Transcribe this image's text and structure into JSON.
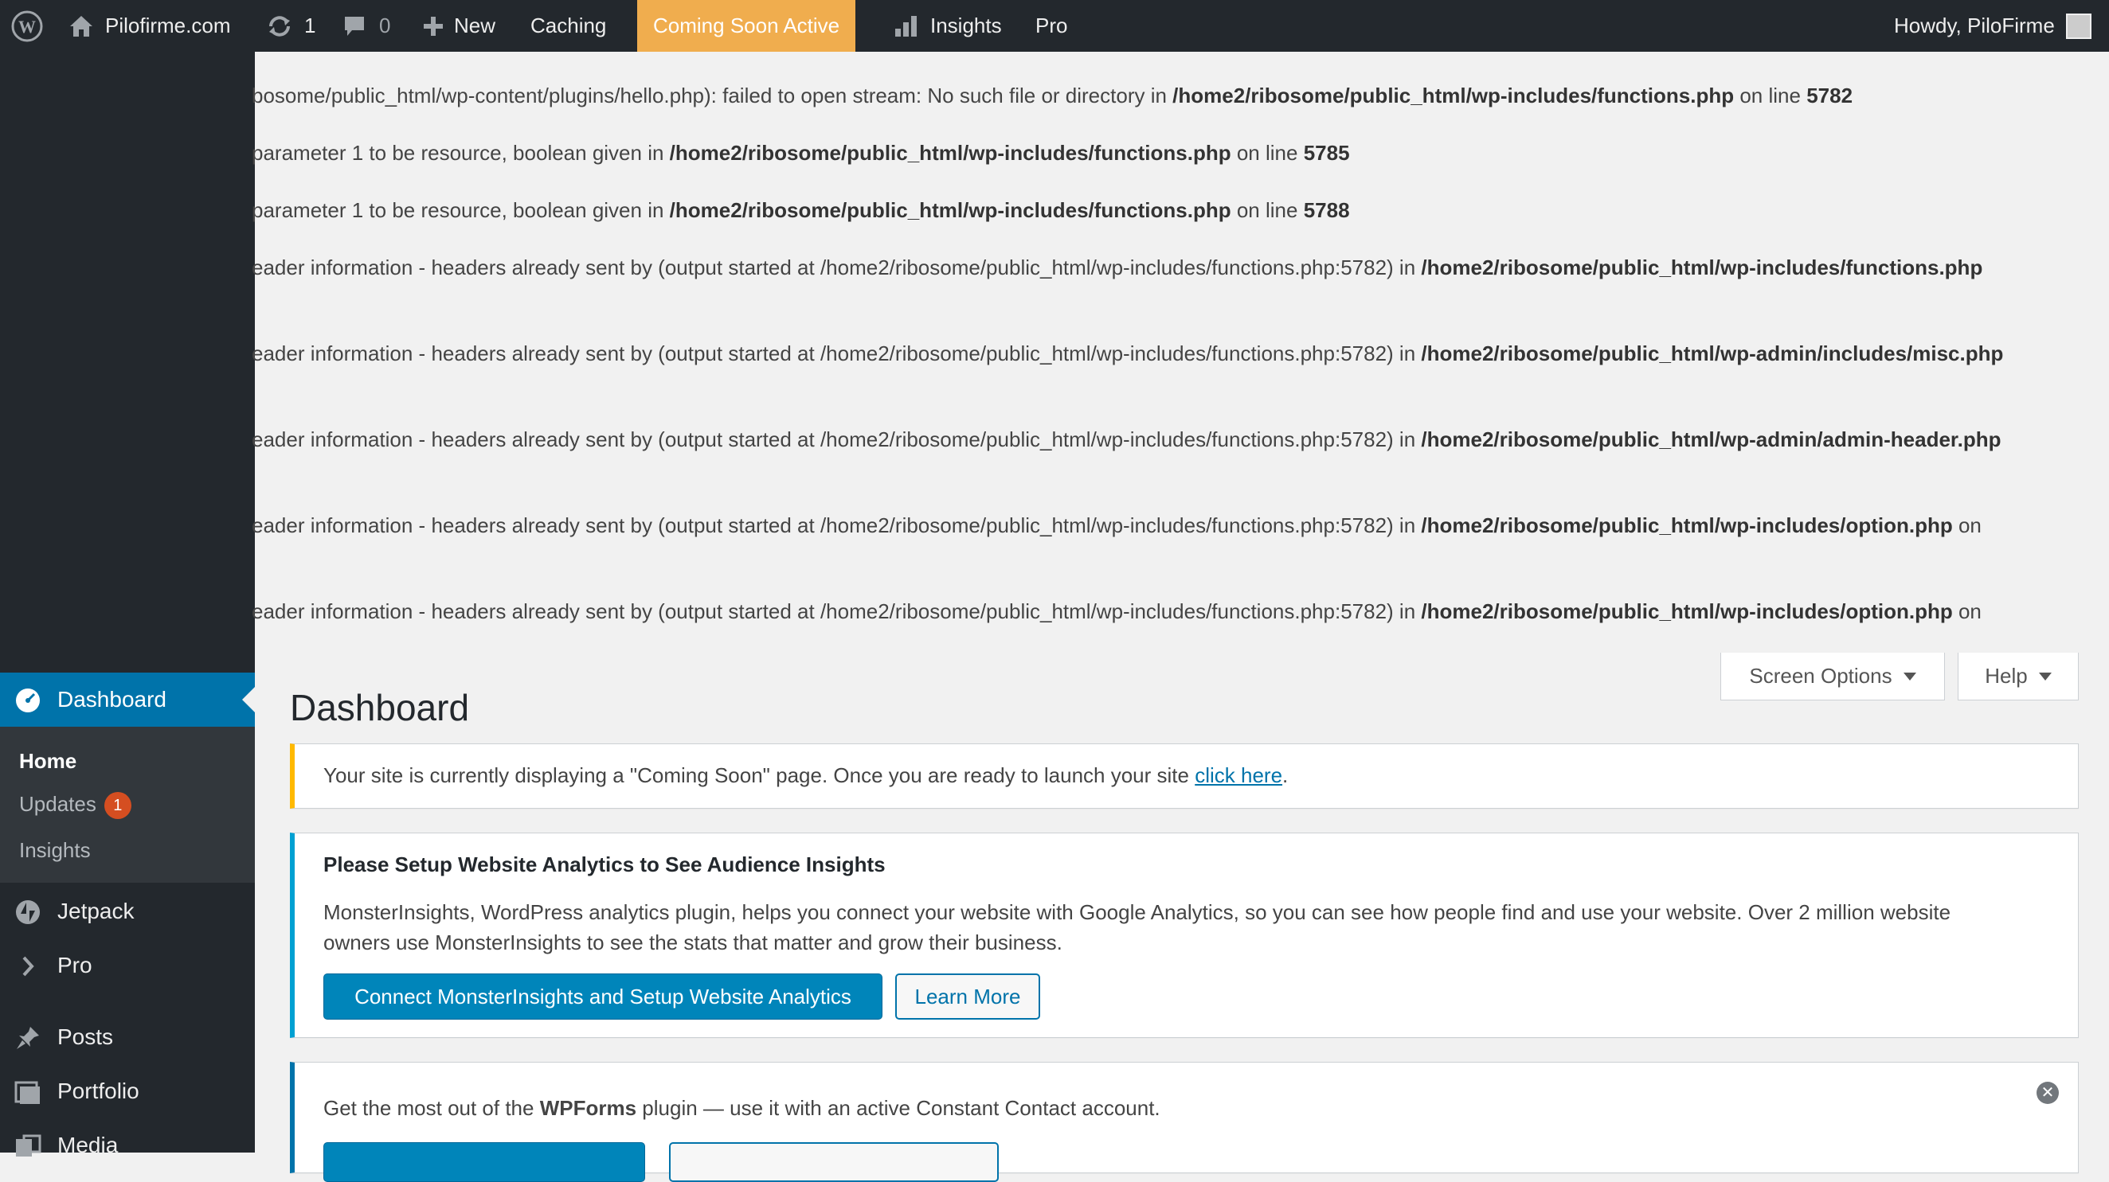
{
  "adminbar": {
    "site_name": "Pilofirme.com",
    "updates_count": "1",
    "comments_count": "0",
    "new_label": "New",
    "caching_label": "Caching",
    "coming_soon_label": "Coming Soon Active",
    "insights_label": "Insights",
    "pro_label": "Pro",
    "howdy": "Howdy, PiloFirme",
    "icons": [
      "wordpress-logo-icon",
      "home-icon",
      "refresh-icon",
      "comment-icon",
      "plus-icon",
      "bar-chart-icon"
    ]
  },
  "errors": [
    {
      "text": "bosome/public_html/wp-content/plugins/hello.php): failed to open stream: No such file or directory in ",
      "path": "/home2/ribosome/public_html/wp-includes/functions.php",
      "suffix": " on line ",
      "line": "5782"
    },
    {
      "text": "parameter 1 to be resource, boolean given in ",
      "path": "/home2/ribosome/public_html/wp-includes/functions.php",
      "suffix": " on line ",
      "line": "5785"
    },
    {
      "text": "parameter 1 to be resource, boolean given in ",
      "path": "/home2/ribosome/public_html/wp-includes/functions.php",
      "suffix": " on line ",
      "line": "5788"
    },
    {
      "text": "eader information - headers already sent by (output started at /home2/ribosome/public_html/wp-includes/functions.php:5782) in ",
      "path": "/home2/ribosome/public_html/wp-includes/functions.php",
      "suffix": "",
      "line": ""
    },
    {
      "text": "eader information - headers already sent by (output started at /home2/ribosome/public_html/wp-includes/functions.php:5782) in ",
      "path": "/home2/ribosome/public_html/wp-admin/includes/misc.php",
      "suffix": "",
      "line": ""
    },
    {
      "text": "eader information - headers already sent by (output started at /home2/ribosome/public_html/wp-includes/functions.php:5782) in ",
      "path": "/home2/ribosome/public_html/wp-admin/admin-header.php",
      "suffix": "",
      "line": ""
    },
    {
      "text": "eader information - headers already sent by (output started at /home2/ribosome/public_html/wp-includes/functions.php:5782) in ",
      "path": "/home2/ribosome/public_html/wp-includes/option.php",
      "suffix": " on",
      "line": ""
    },
    {
      "text": "eader information - headers already sent by (output started at /home2/ribosome/public_html/wp-includes/functions.php:5782) in ",
      "path": "/home2/ribosome/public_html/wp-includes/option.php",
      "suffix": " on",
      "line": ""
    }
  ],
  "sidebar": {
    "dashboard_label": "Dashboard",
    "submenu": {
      "home": "Home",
      "updates": "Updates",
      "updates_badge": "1",
      "insights": "Insights"
    },
    "items": [
      {
        "label": "Jetpack",
        "icon": "jetpack-icon"
      },
      {
        "label": "Pro",
        "icon": "chevron-right-icon"
      },
      {
        "label": "Posts",
        "icon": "pin-icon"
      },
      {
        "label": "Portfolio",
        "icon": "portfolio-icon"
      },
      {
        "label": "Media",
        "icon": "media-icon"
      }
    ]
  },
  "screen_meta": {
    "screen_options": "Screen Options",
    "help": "Help"
  },
  "page_title": "Dashboard",
  "notice_coming_soon": {
    "text": "Your site is currently displaying a \"Coming Soon\" page. Once you are ready to launch your site ",
    "link": "click here",
    "end": "."
  },
  "notice_analytics": {
    "title": "Please Setup Website Analytics to See Audience Insights",
    "body_line1": "MonsterInsights, WordPress analytics plugin, helps you connect your website with Google Analytics, so you can see how people find and use your website. Over 2 million website",
    "body_line2": "owners use MonsterInsights to see the stats that matter and grow their business.",
    "primary_button": "Connect MonsterInsights and Setup Website Analytics",
    "secondary_button": "Learn More"
  },
  "notice_wpforms": {
    "text_pre": "Get the most out of the ",
    "text_bold": "WPForms",
    "text_post": " plugin — use it with an active Constant Contact account.",
    "dismiss": "✕"
  },
  "colors": {
    "adminbar_bg": "#23282d",
    "accent": "#0073aa",
    "coming_soon": "#f0ad4e",
    "warning": "#ffb900",
    "info": "#00a0d2",
    "badge": "#d54e21"
  }
}
